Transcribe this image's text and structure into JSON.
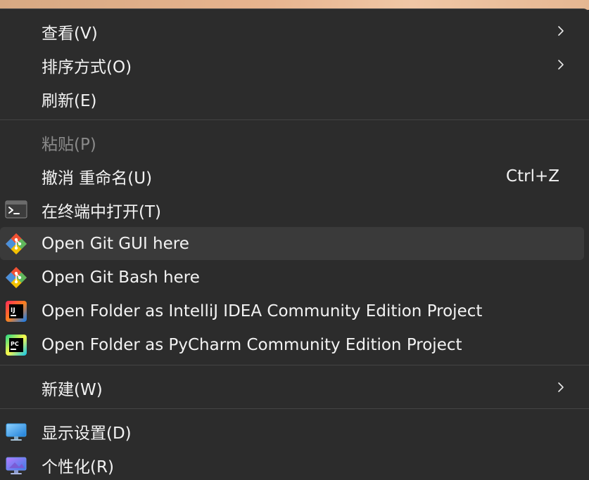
{
  "menu": {
    "items": [
      {
        "label": "查看(V)",
        "submenu": true,
        "icon": ""
      },
      {
        "label": "排序方式(O)",
        "submenu": true,
        "icon": ""
      },
      {
        "label": "刷新(E)",
        "submenu": false,
        "icon": ""
      },
      {
        "label": "粘贴(P)",
        "disabled": true,
        "icon": ""
      },
      {
        "label": "撤消 重命名(U)",
        "shortcut": "Ctrl+Z",
        "icon": ""
      },
      {
        "label": "在终端中打开(T)",
        "icon": "terminal-icon"
      },
      {
        "label": "Open Git GUI here",
        "icon": "git-icon",
        "hover": true
      },
      {
        "label": "Open Git Bash here",
        "icon": "git-icon"
      },
      {
        "label": "Open Folder as IntelliJ IDEA Community Edition Project",
        "icon": "intellij-icon"
      },
      {
        "label": "Open Folder as PyCharm Community Edition Project",
        "icon": "pycharm-icon"
      },
      {
        "label": "新建(W)",
        "submenu": true,
        "icon": ""
      },
      {
        "label": "显示设置(D)",
        "icon": "display-settings-icon"
      },
      {
        "label": "个性化(R)",
        "icon": "personalize-icon"
      }
    ]
  },
  "colors": {
    "menu_bg": "#2c2c2c",
    "hover_bg": "#3a3a3a",
    "text": "#f3f3f3",
    "disabled_text": "#8a8a8a",
    "separator": "#444444"
  }
}
